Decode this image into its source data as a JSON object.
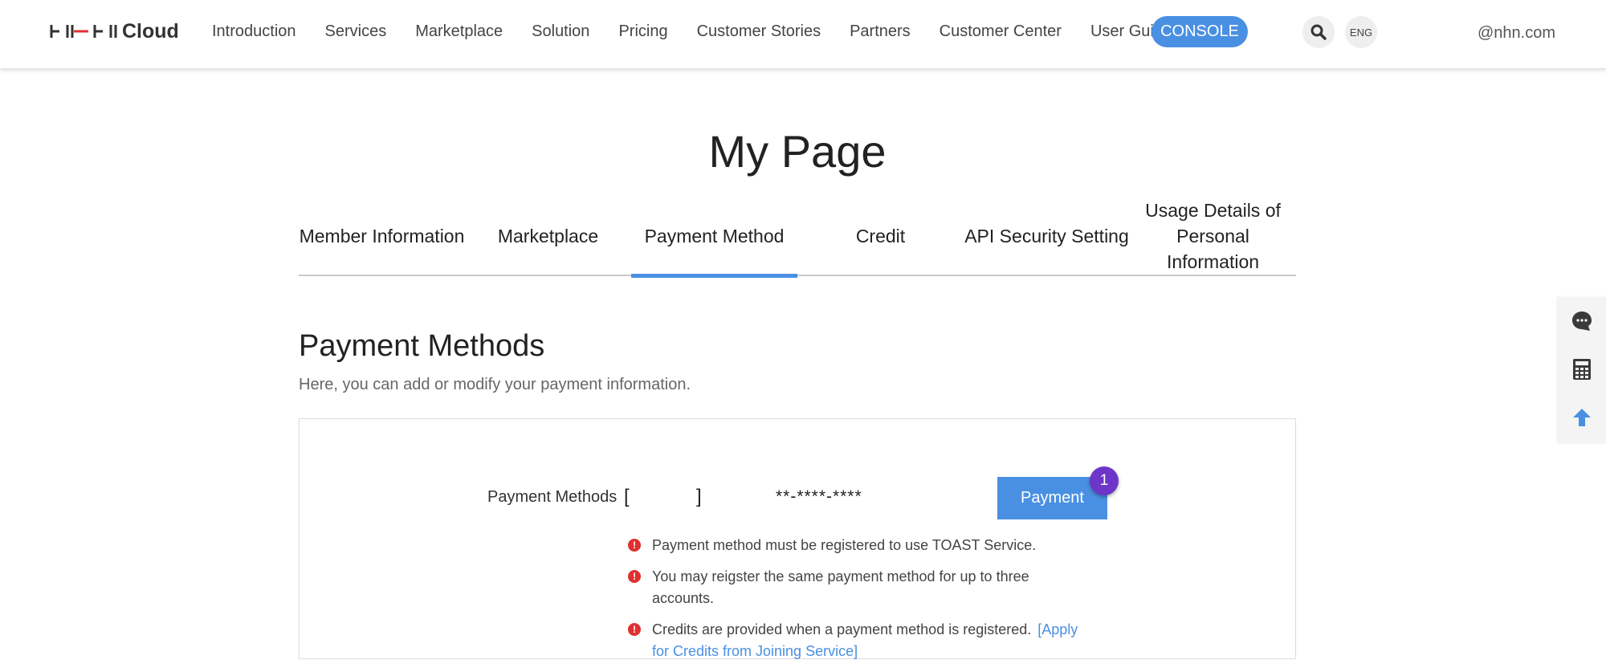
{
  "header": {
    "logo_text": "Cloud",
    "nav": [
      "Introduction",
      "Services",
      "Marketplace",
      "Solution",
      "Pricing",
      "Customer Stories",
      "Partners",
      "Customer Center",
      "User Guide"
    ],
    "console_label": "CONSOLE",
    "lang_label": "ENG",
    "account_label": "@nhn.com"
  },
  "page": {
    "title": "My Page"
  },
  "tabs": [
    {
      "label": "Member Information"
    },
    {
      "label": "Marketplace"
    },
    {
      "label": "Payment Method",
      "active": true
    },
    {
      "label": "Credit"
    },
    {
      "label": "API Security Setting"
    },
    {
      "label": "Usage Details of\nPersonal\nInformation"
    }
  ],
  "section": {
    "title": "Payment Methods",
    "description": "Here, you can add or modify your payment information."
  },
  "payment": {
    "label": "Payment Methods",
    "bracket_open": "[",
    "bracket_close": "]",
    "masked_number": "**-****-****",
    "button_label": "Payment",
    "badge_count": "1"
  },
  "notes": [
    {
      "text": "Payment method must be registered to use TOAST Service."
    },
    {
      "text": "You may reigster the same payment method for up to three accounts."
    },
    {
      "text": "Credits are provided when a payment method is registered.",
      "link": "[Apply for Credits from Joining Service]"
    }
  ],
  "colors": {
    "accent": "#4a90e2",
    "badge": "#6d35c9",
    "alert": "#e03030"
  },
  "side_tools": [
    "chat-icon",
    "calculator-icon",
    "arrow-up-icon"
  ]
}
